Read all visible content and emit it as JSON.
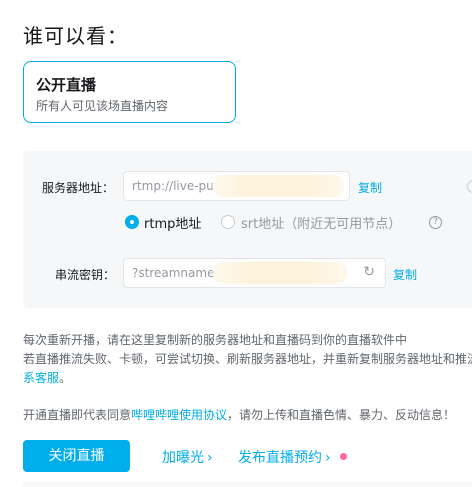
{
  "heading": "谁可以看：",
  "visibility": {
    "title": "公开直播",
    "description": "所有人可见该场直播内容"
  },
  "server": {
    "label": "服务器地址：",
    "value": "rtmp://live-pu",
    "copy_label": "复制"
  },
  "protocol": {
    "options": [
      {
        "label": "rtmp地址",
        "selected": true
      },
      {
        "label": "srt地址（附近无可用节点）",
        "selected": false
      }
    ]
  },
  "stream_key": {
    "label": "串流密钥：",
    "value": "?streamname",
    "copy_label": "复制"
  },
  "notes": {
    "line1": "每次重新开播，请在这里复制新的服务器地址和直播码到你的直播软件中",
    "line2": "若直播推流失败、卡顿，可尝试切换、刷新服务器地址，并重新复制服务器地址和推流",
    "line3_link": "系客服",
    "line3_end": "。",
    "agreement_prefix": "开通直播即代表同意",
    "agreement_link": "哔哩哔哩使用协议",
    "agreement_suffix": "，请勿上传和直播色情、暴力、反动信息！"
  },
  "actions": {
    "close_live": "关闭直播",
    "boost": "加曝光",
    "schedule": "发布直播预约"
  },
  "icons": {
    "help": "question-circle-icon",
    "refresh": "refresh-icon",
    "chevron": "chevron-right-icon"
  },
  "colors": {
    "accent": "#00aeec",
    "panel_bg": "#f6f7f8",
    "badge": "#ff6699"
  }
}
